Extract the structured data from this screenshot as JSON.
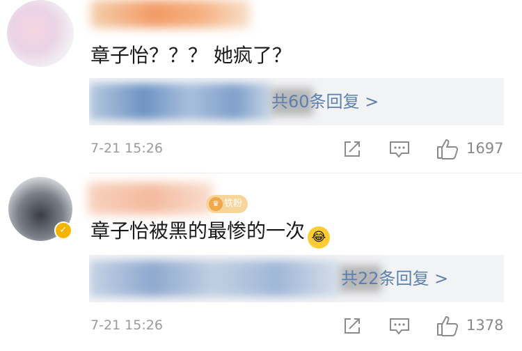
{
  "comments": [
    {
      "text": "章子怡？？？ 她疯了？",
      "reply_link": "共60条回复 >",
      "time": "7-21 15:26",
      "likes": "1697"
    },
    {
      "text": "章子怡被黑的最惨的一次",
      "emoji": "😂",
      "fan_badge": "铁粉",
      "reply_link": "共22条回复 >",
      "time": "7-21 15:26",
      "likes": "1378"
    }
  ],
  "icons": [
    "share-icon",
    "comment-icon",
    "like-icon",
    "verified-badge-icon",
    "laughing-emoji-icon"
  ],
  "colors": {
    "link": "#5b7fae",
    "meta": "#9a9a9a",
    "reply_bg": "#f2f3f5",
    "verified": "#f5b400"
  }
}
